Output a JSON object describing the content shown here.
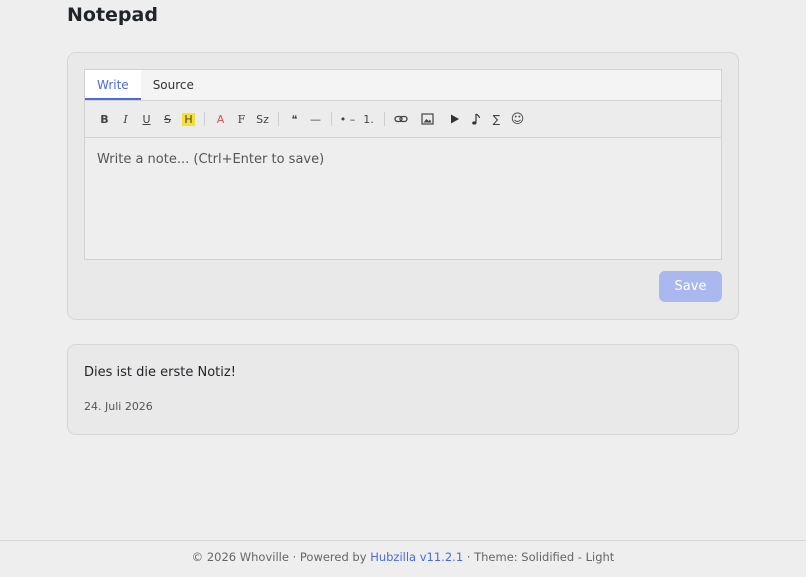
{
  "page": {
    "title": "Notepad"
  },
  "editor": {
    "tabs": [
      {
        "label": "Write",
        "active": true
      },
      {
        "label": "Source",
        "active": false
      }
    ],
    "toolbar": {
      "bold": "B",
      "italic": "I",
      "underline": "U",
      "strike": "S",
      "highlight": "H",
      "color": "A",
      "font": "F",
      "size": "Sz",
      "quote": "❝",
      "hr": "—",
      "bullet_list": "• –",
      "ordered_list": "1.",
      "link_icon": "link-icon",
      "image_icon": "image-icon",
      "video_icon": "play-icon",
      "audio_icon": "music-note-icon",
      "math": "∑",
      "emoji": "☺"
    },
    "placeholder": "Write a note... (Ctrl+Enter to save)",
    "save_label": "Save"
  },
  "notes": [
    {
      "text": "Dies ist die erste Notiz!",
      "date": "24. Juli 2026"
    }
  ],
  "footer": {
    "prefix": "© 2026 Whoville · Powered by ",
    "link": "Hubzilla v11.2.1",
    "suffix": " · Theme: Solidified - Light"
  },
  "colors": {
    "accent": "#4b6bd9",
    "save_button": "#aab8f0",
    "highlight": "#f7e034",
    "text_color_icon": "#d9534f"
  }
}
